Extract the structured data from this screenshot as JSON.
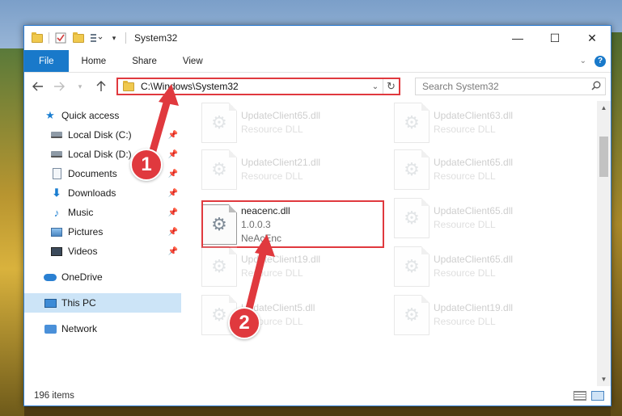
{
  "window": {
    "title": "System32",
    "controls": {
      "minimize": "—",
      "maximize": "☐",
      "close": "✕"
    }
  },
  "ribbon": {
    "tabs": [
      "File",
      "Home",
      "Share",
      "View"
    ],
    "help": "?"
  },
  "address": {
    "path": "C:\\Windows\\System32",
    "search_placeholder": "Search System32"
  },
  "nav_pane": {
    "quick_access": "Quick access",
    "items": [
      {
        "label": "Local Disk (C:)",
        "icon": "disk-icon"
      },
      {
        "label": "Local Disk (D:)",
        "icon": "disk-icon"
      },
      {
        "label": "Documents",
        "icon": "documents-icon"
      },
      {
        "label": "Downloads",
        "icon": "downloads-icon"
      },
      {
        "label": "Music",
        "icon": "music-icon"
      },
      {
        "label": "Pictures",
        "icon": "pictures-icon"
      },
      {
        "label": "Videos",
        "icon": "videos-icon"
      }
    ],
    "onedrive": "OneDrive",
    "this_pc": "This PC",
    "network": "Network"
  },
  "files": [
    {
      "name": "UpdateClient65.dll",
      "sub": "Resource DLL"
    },
    {
      "name": "UpdateClient63.dll",
      "sub": "Resource DLL"
    },
    {
      "name": "UpdateClient21.dll",
      "sub": "Resource DLL"
    },
    {
      "name": "UpdateClient65.dll",
      "sub": "Resource DLL"
    },
    {
      "name": "neacenc.dll",
      "sub": "1.0.0.3",
      "sub2": "NeAcEnc"
    },
    {
      "name": "UpdateClient65.dll",
      "sub": "Resource DLL"
    },
    {
      "name": "UpdateClient19.dll",
      "sub": "Resource DLL"
    },
    {
      "name": "UpdateClient65.dll",
      "sub": "Resource DLL"
    },
    {
      "name": "UpdateClient5.dll",
      "sub": "Resource DLL"
    },
    {
      "name": "UpdateClient19.dll",
      "sub": "Resource DLL"
    }
  ],
  "status": {
    "item_count": "196 items"
  },
  "annotations": {
    "step1": "1",
    "step2": "2"
  },
  "colors": {
    "accent": "#1979ca",
    "highlight": "#e0393e"
  }
}
